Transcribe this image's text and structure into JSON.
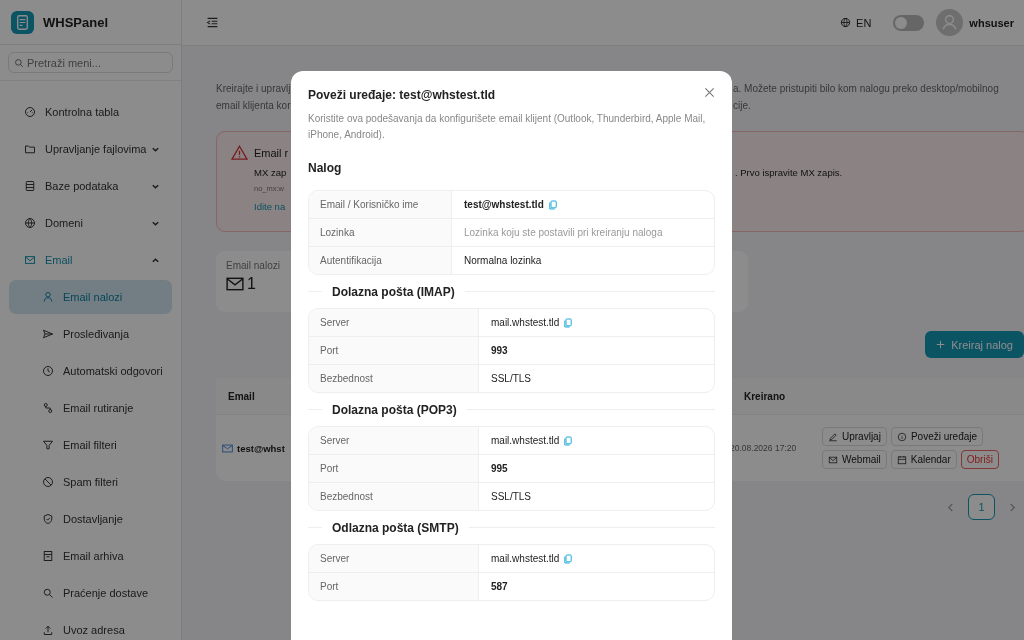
{
  "brand": {
    "name": "WHSPanel"
  },
  "search": {
    "placeholder": "Pretraži meni..."
  },
  "sidebar": {
    "items": [
      {
        "label": "Kontrolna tabla",
        "selected": false
      },
      {
        "label": "Upravljanje fajlovima",
        "selected": false,
        "expanded": false
      },
      {
        "label": "Baze podataka",
        "selected": false,
        "expanded": false
      },
      {
        "label": "Domeni",
        "selected": false,
        "expanded": false
      },
      {
        "label": "Email",
        "selected": true,
        "expanded": true,
        "children": [
          {
            "label": "Email nalozi",
            "selected": true
          },
          {
            "label": "Prosleđivanja",
            "selected": false
          },
          {
            "label": "Automatski odgovori",
            "selected": false
          },
          {
            "label": "Email rutiranje",
            "selected": false
          },
          {
            "label": "Email filteri",
            "selected": false
          },
          {
            "label": "Spam filteri",
            "selected": false
          },
          {
            "label": "Dostavljanje",
            "selected": false
          },
          {
            "label": "Email arhiva",
            "selected": false
          },
          {
            "label": "Praćenje dostave",
            "selected": false
          },
          {
            "label": "Uvoz adresa",
            "selected": false
          }
        ]
      }
    ]
  },
  "topbar": {
    "language": "EN",
    "theme_toggle": {
      "on": false
    },
    "user": "whsuser"
  },
  "intro": [
    {
      "left": "Kreirajte i upravlj",
      "right": "a. Možete pristupiti bilo kom nalogu preko desktop/mobilnog"
    },
    {
      "left": "email klijenta kor",
      "right": "cije."
    }
  ],
  "alert": {
    "title": "Email r",
    "line_left": "MX zap",
    "line_right": ". Prvo ispravite MX zapis.",
    "code": "no_mx:w",
    "link": "Idite na"
  },
  "stats": {
    "label": "Email nalozi",
    "value": "1"
  },
  "create_button": "Kreiraj nalog",
  "table": {
    "columns": [
      "Email",
      "Kreirano"
    ],
    "rows": [
      {
        "email": "test@whst",
        "created": "20.08.2026 17:20",
        "actions": [
          {
            "label": "Upravljaj",
            "kind": "edit"
          },
          {
            "label": "Poveži uređaje",
            "kind": "info"
          },
          {
            "label": "Webmail",
            "kind": "mail"
          },
          {
            "label": "Kalendar",
            "kind": "calendar"
          },
          {
            "label": "Obriši",
            "kind": "danger"
          }
        ]
      }
    ]
  },
  "pagination": {
    "pages": [
      {
        "label": "1",
        "selected": true
      }
    ]
  },
  "modal": {
    "title": "Poveži uređaje: test@whstest.tld",
    "description": "Koristite ova podešavanja da konfigurišete email klijent (Outlook, Thunderbird, Apple Mail, iPhone, Android).",
    "sections": [
      {
        "kind": "account",
        "title": "Nalog",
        "rows": [
          {
            "label": "Email / Korisničko ime",
            "value": "test@whstest.tld",
            "kind": "strong",
            "copyable": true
          },
          {
            "label": "Lozinka",
            "value": "Lozinka koju ste postavili pri kreiranju naloga",
            "kind": "muted",
            "copyable": false
          },
          {
            "label": "Autentifikacija",
            "value": "Normalna lozinka",
            "kind": "normal",
            "copyable": false
          }
        ]
      },
      {
        "kind": "server",
        "title": "Dolazna pošta (IMAP)",
        "rows": [
          {
            "label": "Server",
            "value": "mail.whstest.tld",
            "kind": "normal",
            "copyable": true
          },
          {
            "label": "Port",
            "value": "993",
            "kind": "strong",
            "copyable": false
          },
          {
            "label": "Bezbednost",
            "value": "SSL/TLS",
            "kind": "normal",
            "copyable": false
          }
        ]
      },
      {
        "kind": "server",
        "title": "Dolazna pošta (POP3)",
        "rows": [
          {
            "label": "Server",
            "value": "mail.whstest.tld",
            "kind": "normal",
            "copyable": true
          },
          {
            "label": "Port",
            "value": "995",
            "kind": "strong",
            "copyable": false
          },
          {
            "label": "Bezbednost",
            "value": "SSL/TLS",
            "kind": "normal",
            "copyable": false
          }
        ]
      },
      {
        "kind": "server",
        "title": "Odlazna pošta (SMTP)",
        "rows": [
          {
            "label": "Server",
            "value": "mail.whstest.tld",
            "kind": "normal",
            "copyable": true
          },
          {
            "label": "Port",
            "value": "587",
            "kind": "strong",
            "copyable": false
          }
        ]
      }
    ]
  }
}
